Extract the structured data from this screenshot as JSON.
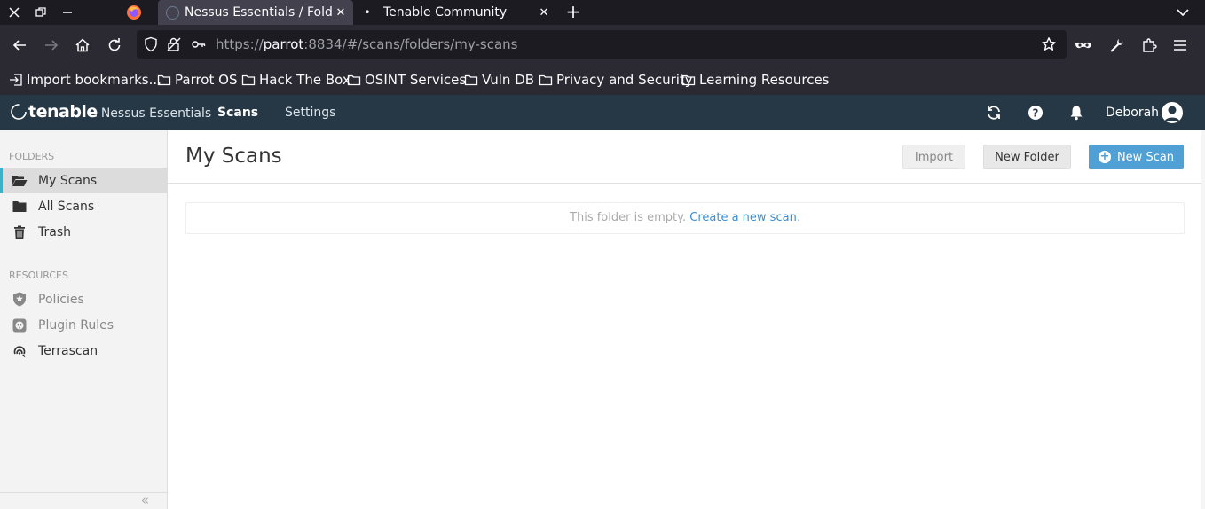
{
  "browser": {
    "tabs": [
      {
        "title": "Nessus Essentials / Folders / My Scans",
        "active": true
      },
      {
        "title": "Tenable Community",
        "active": false
      }
    ],
    "url": {
      "scheme": "https://",
      "host": "parrot",
      "rest": ":8834/#/scans/folders/my-scans"
    },
    "bookmarks": [
      {
        "label": "Import bookmarks...",
        "icon": "import-icon"
      },
      {
        "label": "Parrot OS",
        "icon": "folder-icon"
      },
      {
        "label": "Hack The Box",
        "icon": "folder-icon"
      },
      {
        "label": "OSINT Services",
        "icon": "folder-icon"
      },
      {
        "label": "Vuln DB",
        "icon": "folder-icon"
      },
      {
        "label": "Privacy and Security",
        "icon": "folder-icon"
      },
      {
        "label": "Learning Resources",
        "icon": "folder-icon"
      }
    ]
  },
  "app": {
    "logo": {
      "brand": "tenable",
      "product": "Nessus Essentials"
    },
    "nav": [
      {
        "label": "Scans",
        "active": true
      },
      {
        "label": "Settings",
        "active": false
      }
    ],
    "user": {
      "name": "Deborah"
    }
  },
  "sidebar": {
    "folders_heading": "FOLDERS",
    "folders": [
      {
        "label": "My Scans",
        "icon": "folder-open-icon",
        "active": true
      },
      {
        "label": "All Scans",
        "icon": "folder-icon",
        "active": false
      },
      {
        "label": "Trash",
        "icon": "trash-icon",
        "active": false
      }
    ],
    "resources_heading": "RESOURCES",
    "resources": [
      {
        "label": "Policies",
        "icon": "shield-icon"
      },
      {
        "label": "Plugin Rules",
        "icon": "plugin-icon"
      },
      {
        "label": "Terrascan",
        "icon": "terrascan-icon"
      }
    ],
    "collapse": "«"
  },
  "main": {
    "title": "My Scans",
    "buttons": {
      "import": "Import",
      "new_folder": "New Folder",
      "new_scan": "New Scan"
    },
    "empty_text": "This folder is empty.",
    "empty_link": "Create a new scan",
    "empty_suffix": "."
  },
  "colors": {
    "header": "#263845",
    "accent": "#4fa0d5",
    "active_marker": "#3bb0c9"
  }
}
